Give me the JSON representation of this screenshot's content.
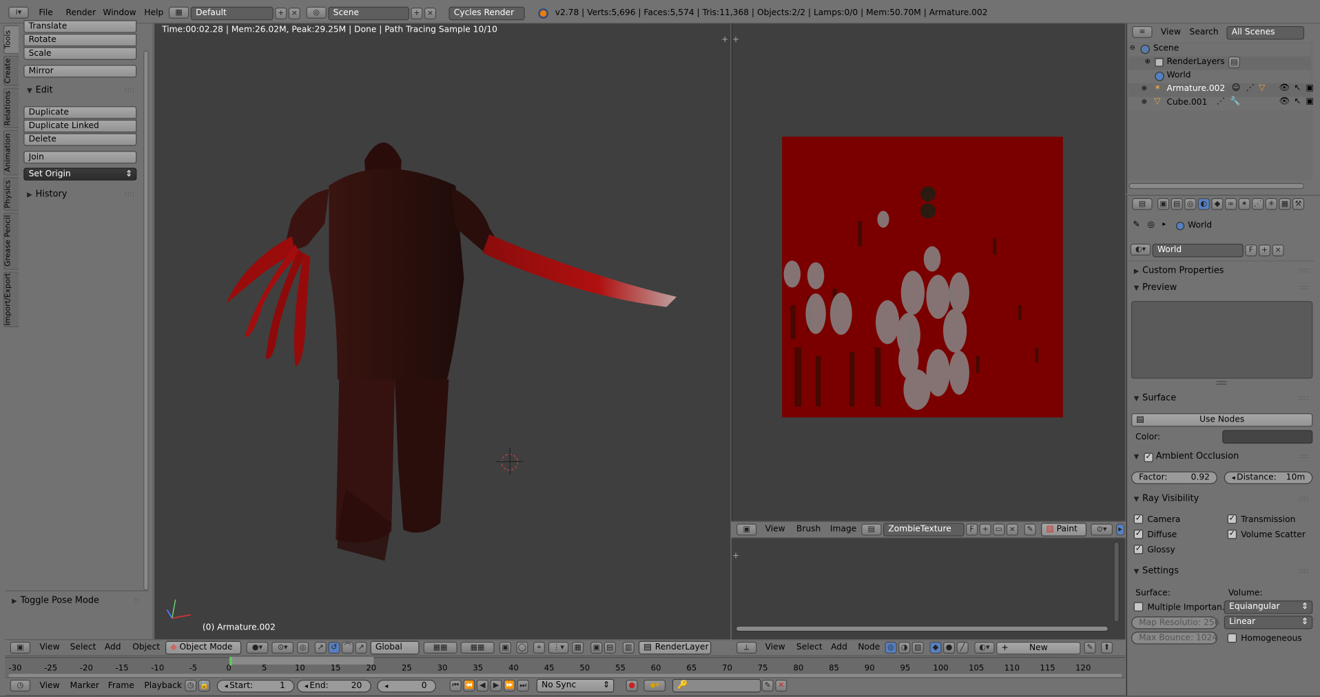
{
  "top_bar": {
    "menus": [
      "File",
      "Render",
      "Window",
      "Help"
    ],
    "layout": "Default",
    "scene": "Scene",
    "engine": "Cycles Render",
    "stats": "v2.78 | Verts:5,696 | Faces:5,574 | Tris:11,368 | Objects:2/2 | Lamps:0/0 | Mem:50.70M | Armature.002"
  },
  "tool_shelf": {
    "tabs": [
      "Tools",
      "Create",
      "Relations",
      "Animation",
      "Physics",
      "Grease Pencil",
      "Import/Export"
    ],
    "transform_buttons": [
      "Translate",
      "Rotate",
      "Scale"
    ],
    "mirror": "Mirror",
    "edit_header": "Edit",
    "edit_buttons": [
      "Duplicate",
      "Duplicate Linked",
      "Delete"
    ],
    "join": "Join",
    "set_origin": "Set Origin",
    "history": "History",
    "operator": "Toggle Pose Mode"
  },
  "viewport": {
    "render_info": "Time:00:02.28 | Mem:26.02M, Peak:29.25M | Done | Path Tracing Sample 10/10",
    "object_label": "(0) Armature.002",
    "header": {
      "menus": [
        "View",
        "Select",
        "Add",
        "Object"
      ],
      "mode": "Object Mode",
      "orientation": "Global",
      "render_layer": "RenderLayer"
    }
  },
  "image_editor": {
    "header": {
      "menus": [
        "View",
        "Brush",
        "Image"
      ],
      "image_name": "ZombieTexture",
      "fake_user": "F",
      "mode": "Paint"
    }
  },
  "node_editor": {
    "header": {
      "menus": [
        "View",
        "Select",
        "Add",
        "Node"
      ],
      "new_button": "New"
    }
  },
  "outliner": {
    "menus": [
      "View",
      "Search"
    ],
    "filter": "All Scenes",
    "items": [
      {
        "label": "Scene",
        "level": 0
      },
      {
        "label": "RenderLayers",
        "level": 1
      },
      {
        "label": "World",
        "level": 1
      },
      {
        "label": "Armature.002",
        "level": 1
      },
      {
        "label": "Cube.001",
        "level": 1
      }
    ]
  },
  "properties": {
    "breadcrumb": "World",
    "world_name": "World",
    "fake_user": "F",
    "custom_properties": "Custom Properties",
    "preview": "Preview",
    "surface": {
      "header": "Surface",
      "use_nodes": "Use Nodes",
      "color_label": "Color:"
    },
    "ambient_occlusion": {
      "header": "Ambient Occlusion",
      "factor_label": "Factor:",
      "factor_value": "0.92",
      "distance_label": "Distance:",
      "distance_value": "10m"
    },
    "ray_visibility": {
      "header": "Ray Visibility",
      "items": [
        "Camera",
        "Transmission",
        "Diffuse",
        "Volume Scatter",
        "Glossy"
      ]
    },
    "settings": {
      "header": "Settings",
      "surface_label": "Surface:",
      "volume_label": "Volume:",
      "multiple_importance": "Multiple Importan...",
      "volume_sampling": "Equiangular",
      "map_resolution": "Map Resolutio: 256",
      "max_bounce": "Max Bounce: 1024",
      "interpolation": "Linear",
      "homogeneous": "Homogeneous"
    }
  },
  "timeline": {
    "ticks": [
      "-30",
      "-25",
      "-20",
      "-15",
      "-10",
      "-5",
      "0",
      "5",
      "10",
      "15",
      "20",
      "25",
      "30",
      "35",
      "40",
      "45",
      "50",
      "55",
      "60",
      "65",
      "70",
      "75",
      "80",
      "85",
      "90",
      "95",
      "100",
      "105",
      "110",
      "115",
      "120"
    ],
    "menus": [
      "View",
      "Marker",
      "Frame",
      "Playback"
    ],
    "start_label": "Start:",
    "start_value": "1",
    "end_label": "End:",
    "end_value": "20",
    "current_frame": "0",
    "sync": "No Sync"
  },
  "colors": {
    "viewport_bg": "#3f3f3f",
    "panel_bg": "#727272",
    "texture_red": "#7a0000",
    "accent_blue": "#5680c2"
  }
}
